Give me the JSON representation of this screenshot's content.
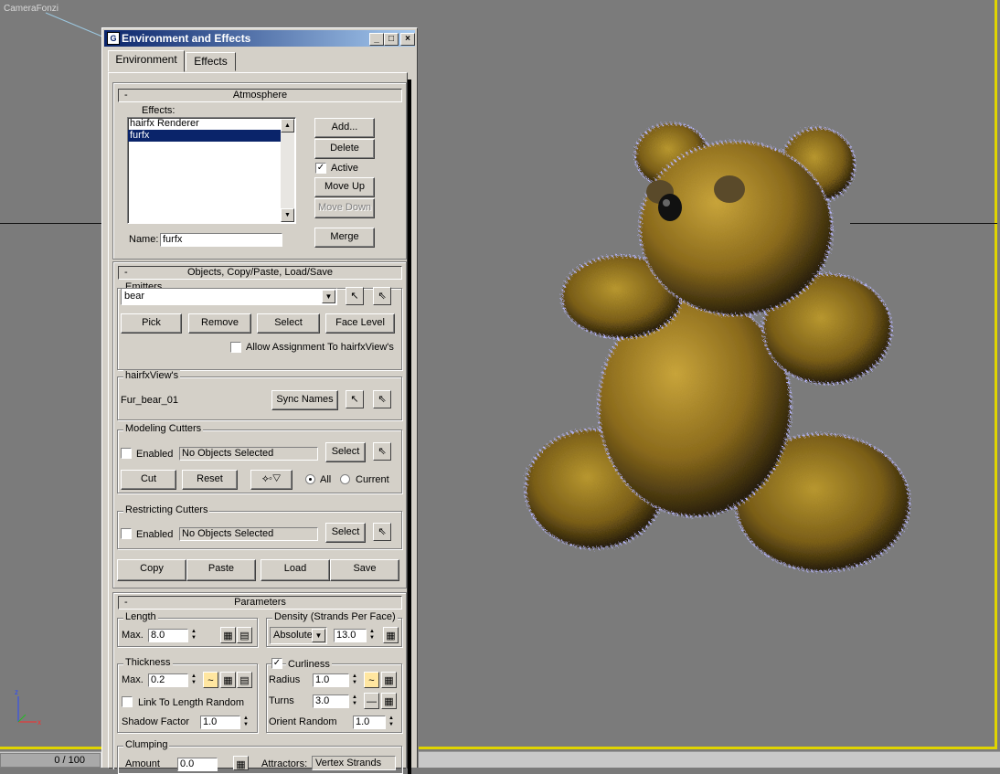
{
  "viewport": {
    "camera_label": "CameraFonzi",
    "frame_counter": "0 / 100"
  },
  "dialog": {
    "title": "Environment and Effects",
    "tabs": [
      "Environment",
      "Effects"
    ],
    "atmosphere": {
      "title": "Atmosphere",
      "effects_label": "Effects:",
      "effects_list": [
        "hairfx Renderer",
        "furfx"
      ],
      "selected": "furfx",
      "add": "Add...",
      "delete": "Delete",
      "active": "Active",
      "move_up": "Move Up",
      "move_down": "Move Down",
      "name_label": "Name:",
      "name_value": "furfx",
      "merge": "Merge"
    },
    "objects": {
      "title": "Objects, Copy/Paste, Load/Save",
      "emitters_label": "Emitters",
      "emitter_value": "bear",
      "pick": "Pick",
      "remove": "Remove",
      "select": "Select",
      "face_level": "Face Level",
      "allow_assign": "Allow Assignment To hairfxView's",
      "hairfxview_label": "hairfxView's",
      "hairfxview_value": "Fur_bear_01",
      "sync_names": "Sync Names",
      "modeling_cutters": "Modeling Cutters",
      "enabled": "Enabled",
      "no_objects": "No Objects Selected",
      "cut": "Cut",
      "reset": "Reset",
      "all": "All",
      "current": "Current",
      "restricting_cutters": "Restricting Cutters",
      "copy": "Copy",
      "paste": "Paste",
      "load": "Load",
      "save": "Save"
    },
    "parameters": {
      "title": "Parameters",
      "length_label": "Length",
      "max_label": "Max.",
      "length_max": "8.0",
      "density_label": "Density (Strands Per Face)",
      "density_mode": "Absolute",
      "density_value": "13.0",
      "thickness_label": "Thickness",
      "thickness_max": "0.2",
      "link_length": "Link To Length Random",
      "shadow_factor_label": "Shadow Factor",
      "shadow_factor": "1.0",
      "curliness_label": "Curliness",
      "radius_label": "Radius",
      "radius": "1.0",
      "turns_label": "Turns",
      "turns": "3.0",
      "orient_random_label": "Orient Random",
      "orient_random": "1.0",
      "clumping_label": "Clumping",
      "amount_label": "Amount",
      "amount": "0.0",
      "attractors_label": "Attractors:",
      "attractors_value": "Vertex Strands"
    }
  }
}
